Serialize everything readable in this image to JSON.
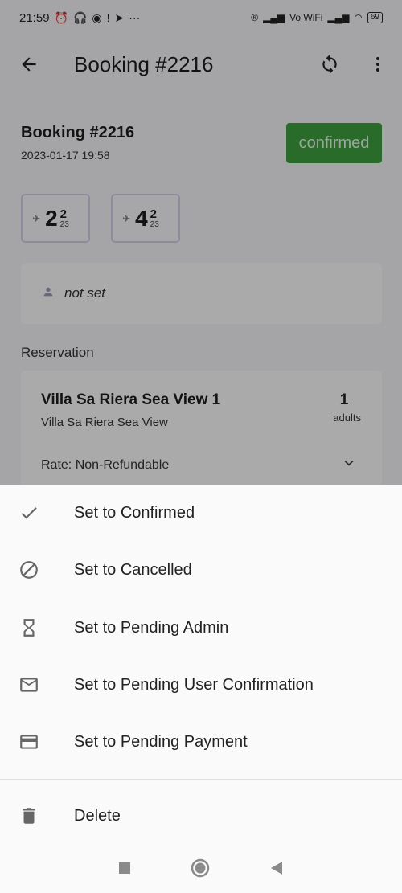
{
  "status_bar": {
    "time": "21:59",
    "battery": "69",
    "net_label": "Vo WiFi"
  },
  "app_bar": {
    "title": "Booking #2216",
    "back_icon": "arrow-back-icon",
    "sync_icon": "sync-icon",
    "more_icon": "more-vert-icon"
  },
  "booking": {
    "name": "Booking #2216",
    "created": "2023-01-17 19:58",
    "status": "confirmed",
    "status_color": "#3d9f3f",
    "checkin": {
      "day": "2",
      "month": "2",
      "year": "23"
    },
    "checkout": {
      "day": "4",
      "month": "2",
      "year": "23"
    },
    "guest": "not set"
  },
  "reservation": {
    "section_label": "Reservation",
    "room_name": "Villa Sa Riera Sea View 1",
    "room_type": "Villa Sa Riera Sea View",
    "count": "1",
    "count_unit": "adults",
    "rate": "Rate: Non-Refundable"
  },
  "sheet": {
    "items": [
      {
        "label": "Set to Confirmed",
        "icon": "check-icon"
      },
      {
        "label": "Set to Cancelled",
        "icon": "block-icon"
      },
      {
        "label": "Set to Pending Admin",
        "icon": "hourglass-icon"
      },
      {
        "label": "Set to Pending User Confirmation",
        "icon": "mail-icon"
      },
      {
        "label": "Set to Pending Payment",
        "icon": "credit-card-icon"
      }
    ],
    "delete_label": "Delete",
    "delete_icon": "trash-icon"
  },
  "nav_bar": {
    "recents_icon": "square-icon",
    "home_icon": "circle-icon",
    "back_icon": "triangle-back-icon"
  }
}
